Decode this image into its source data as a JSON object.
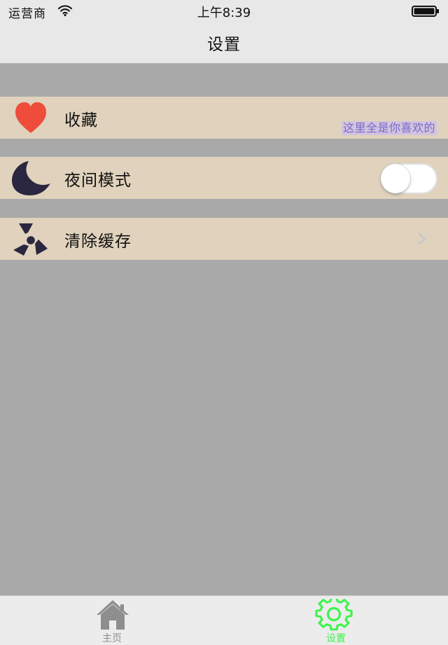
{
  "status_bar": {
    "carrier": "运营商",
    "time": "上午8:39",
    "icons": [
      "wifi-icon",
      "battery-icon"
    ]
  },
  "nav_bar": {
    "title": "设置"
  },
  "rows": [
    {
      "icon": "heart-icon",
      "label": "收藏",
      "subtitle": "这里全是你喜欢的",
      "accessory": "none"
    },
    {
      "icon": "moon-icon",
      "label": "夜间模式",
      "accessory": "toggle",
      "toggle_on": false
    },
    {
      "icon": "radiation-icon",
      "label": "清除缓存",
      "accessory": "chevron-right-icon"
    }
  ],
  "tab_bar": {
    "tabs": [
      {
        "label": "主页",
        "icon": "home-icon",
        "active": false
      },
      {
        "label": "设置",
        "icon": "gear-icon",
        "active": true
      }
    ]
  },
  "colors": {
    "background": "#a9a9a9",
    "row_background": "#e0d2bc",
    "heart": "#ef4d3c",
    "dark_icon": "#2b2740",
    "subtitle_text": "#7c69c9",
    "subtitle_bg": "#d2c3df",
    "active_tab": "#3ef34c",
    "inactive_tab": "#8e8e8e"
  }
}
